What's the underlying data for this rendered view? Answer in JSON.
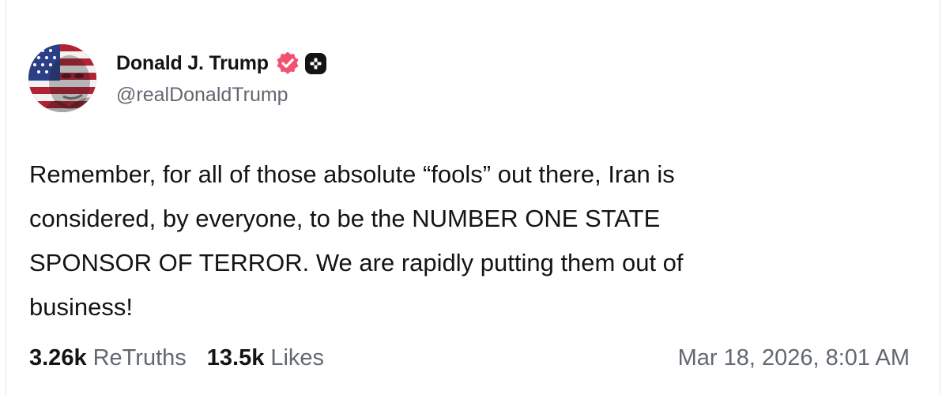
{
  "author": {
    "display_name": "Donald J. Trump",
    "handle": "@realDonaldTrump",
    "avatar_icon": "flag-portrait-avatar",
    "verified_icon": "verified-badge-icon",
    "plus_icon": "plus-badge-icon"
  },
  "post": {
    "text": "Remember, for all of those absolute “fools” out there, Iran is\nconsidered, by everyone, to be the NUMBER ONE STATE\nSPONSOR OF TERROR. We are rapidly putting them out of\nbusiness!"
  },
  "stats": {
    "retruths_count": "3.26k",
    "retruths_label": "ReTruths",
    "likes_count": "13.5k",
    "likes_label": "Likes"
  },
  "timestamp": "Mar 18, 2026, 8:01 AM",
  "colors": {
    "verified_badge": "#f25272",
    "text_primary": "#141414",
    "text_secondary": "#626870"
  }
}
